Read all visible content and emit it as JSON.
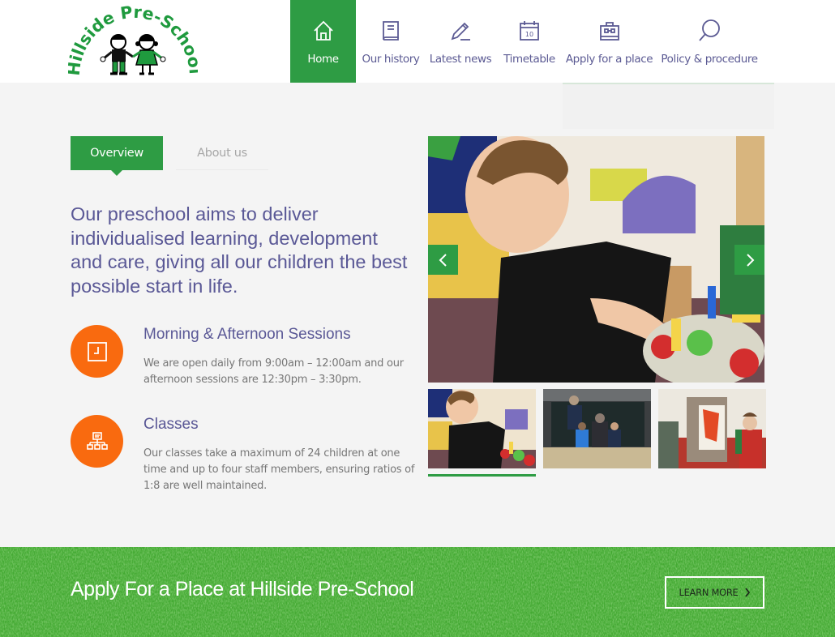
{
  "header": {
    "logo": {
      "alt": "Hillside Pre-School logo",
      "text_line": "Hillside Pre-School"
    },
    "nav": [
      {
        "label": "Home",
        "icon": "home-icon",
        "active": true
      },
      {
        "label": "Our history",
        "icon": "book-icon",
        "active": false
      },
      {
        "label": "Latest news",
        "icon": "pencil-icon",
        "active": false
      },
      {
        "label": "Timetable",
        "icon": "calendar-icon",
        "active": false
      },
      {
        "label": "Apply for a place",
        "icon": "briefcase-icon",
        "active": false
      },
      {
        "label": "Policy & procedure",
        "icon": "search-icon",
        "active": false
      }
    ],
    "calendar_day": "10"
  },
  "main": {
    "tabs": [
      {
        "label": "Overview",
        "active": true
      },
      {
        "label": "About us",
        "active": false
      }
    ],
    "lead": "Our preschool aims to deliver individualised learning, development and care, giving all our children the best possible start in life.",
    "features": [
      {
        "icon": "clock-icon",
        "title": "Morning & Afternoon Sessions",
        "text": "We are open daily from 9:00am – 12:00am and our afternoon sessions are 12:30pm – 3:30pm."
      },
      {
        "icon": "sitemap-icon",
        "title": "Classes",
        "text": "Our classes take a maximum of 24 children at one time and up to four staff members, ensuring ratios of 1:8 are well maintained."
      }
    ]
  },
  "slider": {
    "main_image_alt": "Boy playing with colourful construction toys",
    "prev_label": "Previous slide",
    "next_label": "Next slide",
    "thumbnails": [
      {
        "alt": "Boy playing with construction toys",
        "active": true
      },
      {
        "alt": "Children drawing on outdoor chalkboard",
        "active": false
      },
      {
        "alt": "Children painting at an easel",
        "active": false
      }
    ]
  },
  "banner": {
    "title": "Apply For a Place at Hillside Pre-School",
    "button_label": "LEARN MORE"
  },
  "colors": {
    "brand_green": "#2e9c44",
    "nav_text": "#5b5a93",
    "heading_purple": "#5a5896",
    "accent_orange": "#f96a0f",
    "background": "#f4f4f4"
  }
}
